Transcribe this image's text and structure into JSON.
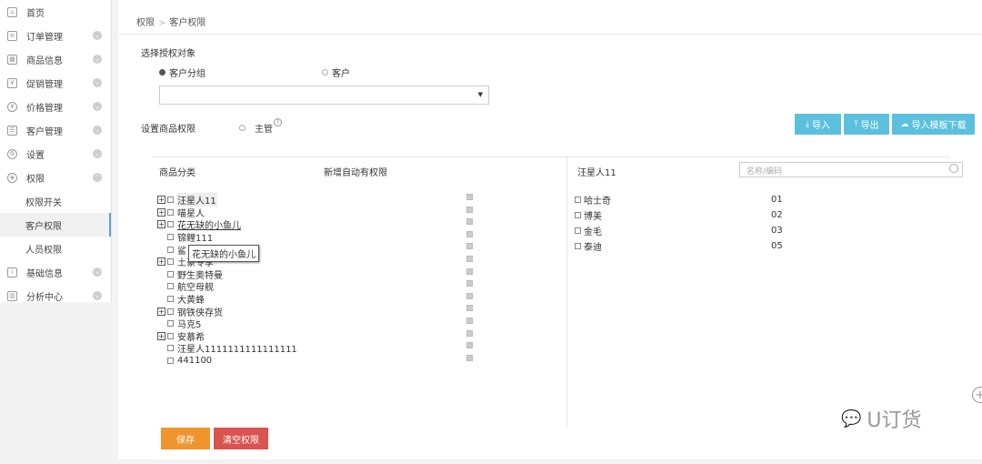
{
  "sidebar": {
    "items": [
      {
        "label": "首页",
        "chevron": false
      },
      {
        "label": "订单管理",
        "chevron": true
      },
      {
        "label": "商品信息",
        "chevron": true
      },
      {
        "label": "促销管理",
        "chevron": true
      },
      {
        "label": "价格管理",
        "chevron": true
      },
      {
        "label": "客户管理",
        "chevron": true
      },
      {
        "label": "设置",
        "chevron": true
      },
      {
        "label": "权限",
        "chevron": true
      }
    ],
    "subitems": [
      "权限开关",
      "客户权限",
      "人员权限"
    ],
    "items_after": [
      {
        "label": "基础信息"
      },
      {
        "label": "分析中心"
      }
    ]
  },
  "breadcrumb": {
    "root": "权限",
    "sep": ">",
    "current": "客户权限"
  },
  "auth_target": {
    "title": "选择授权对象",
    "option_group": "客户分组",
    "option_customer": "客户",
    "selected": "客户分组"
  },
  "product_auth": {
    "title": "设置商品权限",
    "manager_label": "主管",
    "help": "?"
  },
  "toolbar": {
    "import": "导入",
    "export": "导出",
    "template": "导入模板下载"
  },
  "panel": {
    "col_category": "商品分类",
    "col_auto": "新增自动有权限",
    "selected_user": "汪星人11",
    "search_placeholder": "名称/编码",
    "tree": [
      {
        "label": "汪星人11",
        "expandable": true,
        "highlight": true
      },
      {
        "label": "喵星人",
        "expandable": true
      },
      {
        "label": "花无缺的小鱼儿",
        "expandable": true
      },
      {
        "label": "锦鲤111",
        "expandable": false
      },
      {
        "label": "鲨",
        "expandable": false
      },
      {
        "label": "土豪专享",
        "expandable": true
      },
      {
        "label": "野生奥特曼",
        "expandable": false
      },
      {
        "label": "航空母舰",
        "expandable": false
      },
      {
        "label": "大黄蜂",
        "expandable": false
      },
      {
        "label": "钢铁侠存货",
        "expandable": true
      },
      {
        "label": "马克5",
        "expandable": false
      },
      {
        "label": "安慕希",
        "expandable": true
      },
      {
        "label": "汪星人1111111111111111",
        "expandable": false
      },
      {
        "label": "441100",
        "expandable": false
      }
    ],
    "tooltip": "花无缺的小鱼儿",
    "users": [
      {
        "name": "哈士奇",
        "code": "01"
      },
      {
        "name": "博美",
        "code": "02"
      },
      {
        "name": "金毛",
        "code": "03"
      },
      {
        "name": "泰迪",
        "code": "05"
      }
    ]
  },
  "actions": {
    "save": "保存",
    "clear": "清空权限"
  },
  "watermark": "U订货",
  "colors": {
    "primary_btn": "#5bc0de",
    "save": "#f0952e",
    "clear": "#d9534f"
  }
}
